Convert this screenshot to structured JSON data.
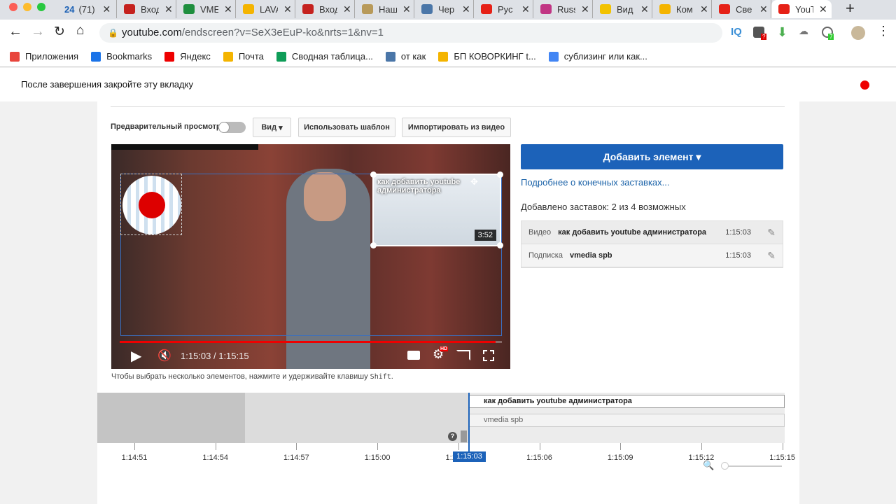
{
  "browser": {
    "tabs": [
      {
        "label": "(71)",
        "prefix": "24",
        "color": "#1a5fb4"
      },
      {
        "label": "Входящие",
        "color": "#c5221f"
      },
      {
        "label": "VMEDIA",
        "color": "#1e8e3e"
      },
      {
        "label": "LAVA",
        "color": "#f4b400"
      },
      {
        "label": "Входящие",
        "color": "#c5221f"
      },
      {
        "label": "Наш",
        "color": "#b89a5a"
      },
      {
        "label": "Чер",
        "color": "#4a76a8"
      },
      {
        "label": "Рус",
        "color": "#e62117"
      },
      {
        "label": "Russ",
        "color": "#c13584"
      },
      {
        "label": "Вид",
        "color": "#f2c200"
      },
      {
        "label": "Ком",
        "color": "#f4b400"
      },
      {
        "label": "Све",
        "color": "#e62117"
      },
      {
        "label": "YouTube",
        "color": "#e62117",
        "active": true
      }
    ],
    "url_host": "youtube.com",
    "url_path": "/endscreen?v=SeX3eEuP-ko&nrts=1&nv=1",
    "extension_badges": [
      "?",
      "7"
    ],
    "extension_iq": "IQ",
    "bookmarks": [
      {
        "label": "Приложения",
        "color": "#e8453c"
      },
      {
        "label": "Bookmarks",
        "color": "#1a73e8"
      },
      {
        "label": "Яндекс",
        "color": "#e00"
      },
      {
        "label": "Почта",
        "color": "#f4b400"
      },
      {
        "label": "Сводная таблица...",
        "color": "#0f9d58"
      },
      {
        "label": "от как",
        "color": "#4a76a8"
      },
      {
        "label": "БП КОВОРКИНГ t...",
        "color": "#f4b400"
      },
      {
        "label": "сублизинг или как...",
        "color": "#4285f4"
      }
    ]
  },
  "page": {
    "header_text": "После завершения закройте эту вкладку",
    "toolbar": {
      "preview_label": "Предварительный просмотр",
      "preview_on": false,
      "view_label": "Вид",
      "template_label": "Использовать шаблон",
      "import_label": "Импортировать из видео"
    },
    "video": {
      "time": "1:15:03 / 1:15:15",
      "progress": 0.984,
      "card_title": "как добавить youtube администратора",
      "card_duration": "3:52",
      "hd_badge": "HD"
    },
    "hint": "Чтобы выбрать несколько элементов, нажмите и удерживайте клавишу ",
    "hint_key": "Shift",
    "add_element_label": "Добавить элемент",
    "learn_more": "Подробнее о конечных заставках...",
    "count_text": "Добавлено заставок: 2 из 4 возможных",
    "elements": [
      {
        "type": "Видео",
        "title": "как добавить youtube администратора",
        "time": "1:15:03"
      },
      {
        "type": "Подписка",
        "title": "vmedia spb",
        "time": "1:15:03"
      }
    ],
    "timeline": {
      "ticks": [
        "1:14:51",
        "1:14:54",
        "1:14:57",
        "1:15:00",
        "1:15:03",
        "1:15:06",
        "1:15:09",
        "1:15:12",
        "1:15:15"
      ],
      "playhead": "1:15:03",
      "tracks": [
        "как добавить youtube администратора",
        "vmedia spb"
      ],
      "help": "?"
    },
    "accent": "#1c62b9"
  }
}
